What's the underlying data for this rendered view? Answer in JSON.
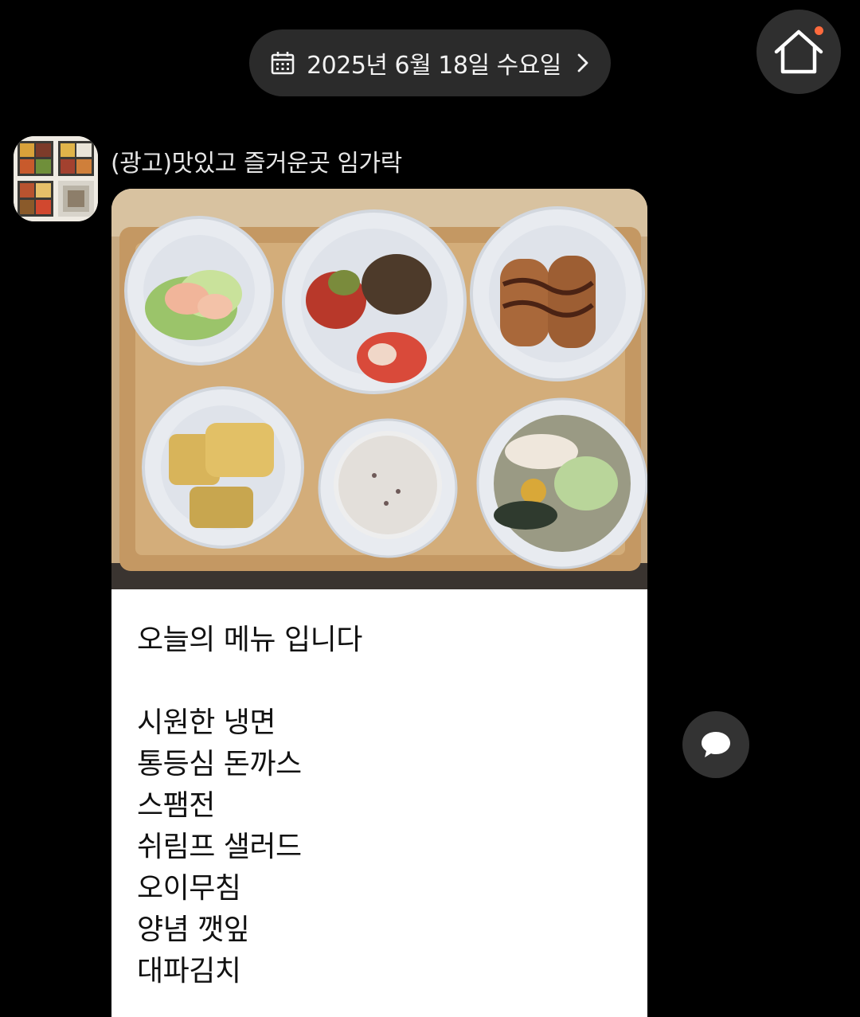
{
  "date_bar": {
    "label": "2025년 6월 18일 수요일",
    "icon": "calendar-icon",
    "arrow_icon": "chevron-right-icon"
  },
  "home": {
    "icon": "home-icon",
    "notification_dot_color": "#ff6a3d"
  },
  "message": {
    "sender": "(광고)맛있고 즐거운곳 임가락",
    "avatar_icon": "lunchbox-photo",
    "photo_description_icon": "food-tray-photo",
    "title": "오늘의 메뉴 입니다",
    "menu_items": [
      "시원한 냉면",
      "통등심 돈까스",
      "스팸전",
      "쉬림프 샐러드",
      "오이무침",
      "양념 깻잎",
      "대파김치"
    ]
  },
  "comment_button": {
    "icon": "chat-bubble-icon"
  },
  "colors": {
    "background": "#000000",
    "pill": "#2b2b2b",
    "card": "#ffffff",
    "accent_dot": "#ff6a3d"
  }
}
